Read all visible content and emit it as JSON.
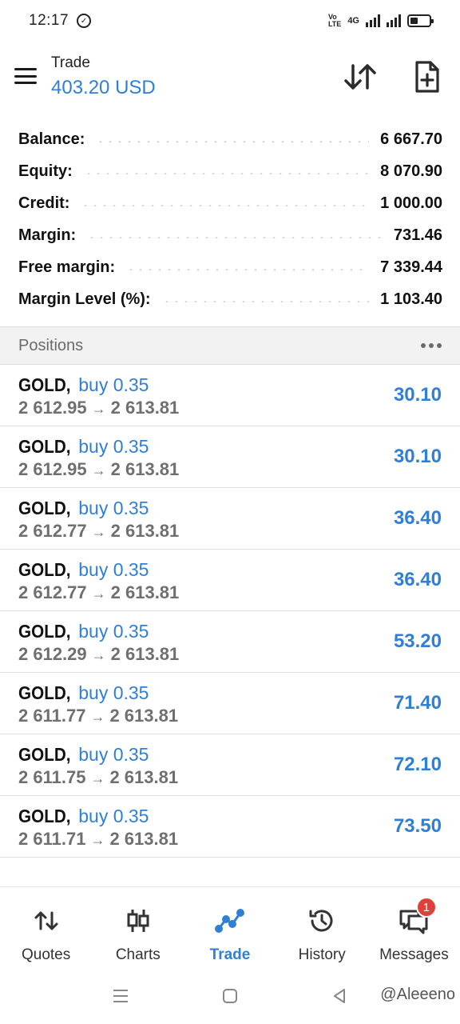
{
  "status_bar": {
    "time": "12:17",
    "network": "4G"
  },
  "header": {
    "title": "Trade",
    "balance": "403.20 USD"
  },
  "summary": [
    {
      "label": "Balance:",
      "value": "6 667.70"
    },
    {
      "label": "Equity:",
      "value": "8 070.90"
    },
    {
      "label": "Credit:",
      "value": "1 000.00"
    },
    {
      "label": "Margin:",
      "value": "731.46"
    },
    {
      "label": "Free margin:",
      "value": "7 339.44"
    },
    {
      "label": "Margin Level (%):",
      "value": "1 103.40"
    }
  ],
  "positions_title": "Positions",
  "positions": [
    {
      "symbol": "GOLD,",
      "side": "buy 0.35",
      "open": "2 612.95",
      "arrow": "→",
      "current": "2 613.81",
      "profit": "30.10"
    },
    {
      "symbol": "GOLD,",
      "side": "buy 0.35",
      "open": "2 612.95",
      "arrow": "→",
      "current": "2 613.81",
      "profit": "30.10"
    },
    {
      "symbol": "GOLD,",
      "side": "buy 0.35",
      "open": "2 612.77",
      "arrow": "→",
      "current": "2 613.81",
      "profit": "36.40"
    },
    {
      "symbol": "GOLD,",
      "side": "buy 0.35",
      "open": "2 612.77",
      "arrow": "→",
      "current": "2 613.81",
      "profit": "36.40"
    },
    {
      "symbol": "GOLD,",
      "side": "buy 0.35",
      "open": "2 612.29",
      "arrow": "→",
      "current": "2 613.81",
      "profit": "53.20"
    },
    {
      "symbol": "GOLD,",
      "side": "buy 0.35",
      "open": "2 611.77",
      "arrow": "→",
      "current": "2 613.81",
      "profit": "71.40"
    },
    {
      "symbol": "GOLD,",
      "side": "buy 0.35",
      "open": "2 611.75",
      "arrow": "→",
      "current": "2 613.81",
      "profit": "72.10"
    },
    {
      "symbol": "GOLD,",
      "side": "buy 0.35",
      "open": "2 611.71",
      "arrow": "→",
      "current": "2 613.81",
      "profit": "73.50"
    }
  ],
  "nav": {
    "quotes": "Quotes",
    "charts": "Charts",
    "trade": "Trade",
    "history": "History",
    "messages": "Messages",
    "messages_badge": "1"
  },
  "watermark": "@Aleeeno",
  "colors": {
    "accent": "#2f7fd6",
    "badge": "#e0403a"
  },
  "icons": [
    "menu-icon",
    "sort-icon",
    "new-order-icon",
    "more-icon",
    "quotes-icon",
    "charts-icon",
    "trade-icon",
    "history-icon",
    "messages-icon"
  ]
}
